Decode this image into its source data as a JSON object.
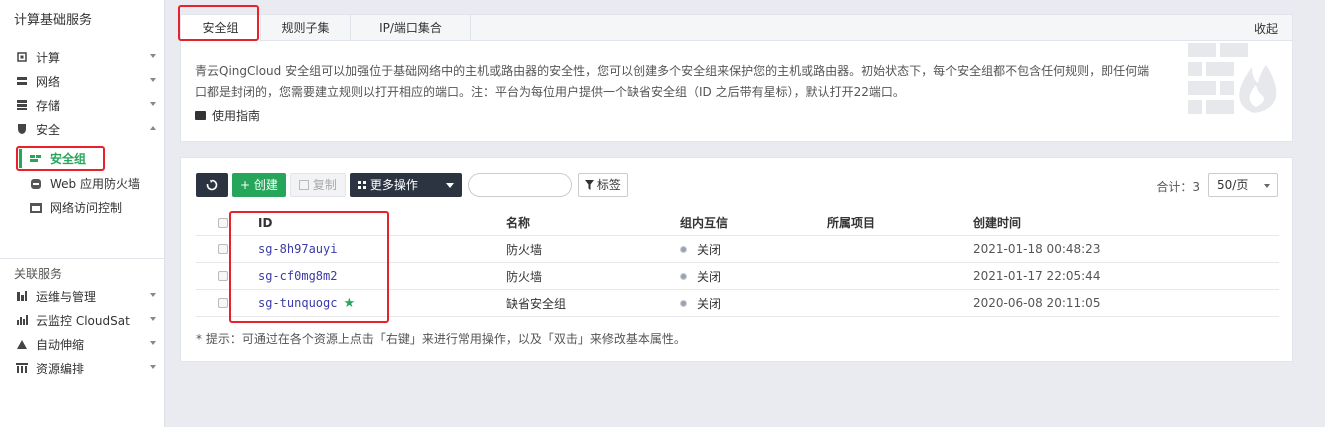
{
  "sidebar": {
    "title": "计算基础服务",
    "items": [
      {
        "label": "计算",
        "icon": "cpu-icon"
      },
      {
        "label": "网络",
        "icon": "network-icon"
      },
      {
        "label": "存储",
        "icon": "storage-icon"
      },
      {
        "label": "安全",
        "icon": "shield-icon"
      }
    ],
    "security_sub": [
      {
        "label": "安全组",
        "icon": "firewall-icon"
      },
      {
        "label": "Web 应用防火墙",
        "icon": "waf-icon"
      },
      {
        "label": "网络访问控制",
        "icon": "access-control-icon"
      }
    ],
    "related_title": "关联服务",
    "related": [
      {
        "label": "运维与管理",
        "icon": "ops-icon"
      },
      {
        "label": "云监控 CloudSat",
        "icon": "monitor-icon"
      },
      {
        "label": "自动伸缩",
        "icon": "autoscale-icon"
      },
      {
        "label": "资源编排",
        "icon": "orchestration-icon"
      }
    ]
  },
  "tabs": [
    "安全组",
    "规则子集",
    "IP/端口集合"
  ],
  "collapse_label": "收起",
  "description": "青云QingCloud 安全组可以加强位于基础网络中的主机或路由器的安全性，您可以创建多个安全组来保护您的主机或路由器。初始状态下，每个安全组都不包含任何规则，即任何端口都是封闭的，您需要建立规则以打开相应的端口。注：平台为每位用户提供一个缺省安全组（ID 之后带有星标），默认打开22端口。",
  "guide_label": "使用指南",
  "toolbar": {
    "refresh_icon": "refresh-icon",
    "create_label": "+ 创建",
    "copy_label": "复制",
    "more_label": "更多操作",
    "search_placeholder": "",
    "tag_label": "标签",
    "total_label": "合计：3",
    "page_size": "50/页"
  },
  "table": {
    "columns": [
      "ID",
      "名称",
      "组内互信",
      "所属项目",
      "创建时间"
    ],
    "rows": [
      {
        "id": "sg-8h97auyi",
        "name": "防火墙",
        "trust": "关闭",
        "project": "",
        "created": "2021-01-18 00:48:23",
        "default": false
      },
      {
        "id": "sg-cf0mg8m2",
        "name": "防火墙",
        "trust": "关闭",
        "project": "",
        "created": "2021-01-17 22:05:44",
        "default": false
      },
      {
        "id": "sg-tunquogc",
        "name": "缺省安全组",
        "trust": "关闭",
        "project": "",
        "created": "2020-06-08 20:11:05",
        "default": true
      }
    ]
  },
  "tip": "* 提示：可通过在各个资源上点击「右键」来进行常用操作，以及「双击」来修改基本属性。",
  "colors": {
    "accent_green": "#26a65b",
    "highlight_red": "#e8212a",
    "dark_button": "#2b3440"
  }
}
